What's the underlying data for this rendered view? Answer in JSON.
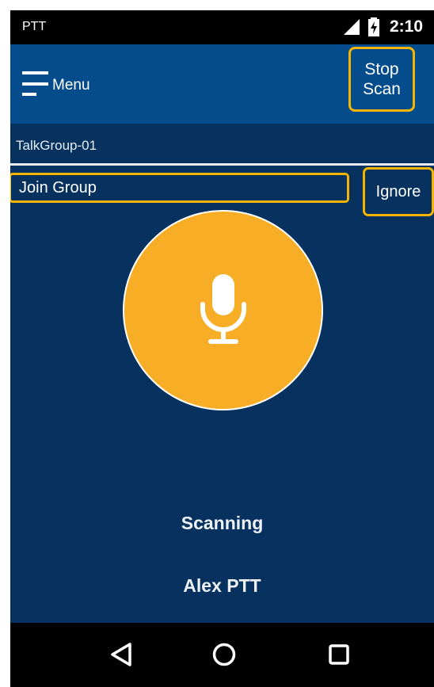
{
  "status_bar": {
    "app_label": "PTT",
    "time": "2:10",
    "icons": [
      "signal-icon",
      "battery-charging-icon"
    ]
  },
  "toolbar": {
    "menu_label": "Menu",
    "menu_icon": "hamburger-menu-icon",
    "stop_scan_line1": "Stop",
    "stop_scan_line2": "Scan"
  },
  "talkgroup": {
    "name": "TalkGroup-01"
  },
  "actions": {
    "join_label": "Join Group",
    "ignore_label": "Ignore"
  },
  "ptt": {
    "icon": "microphone-icon",
    "status": "Scanning",
    "user": "Alex PTT"
  },
  "nav": {
    "icons": [
      "back-icon",
      "home-icon",
      "recent-apps-icon"
    ]
  },
  "colors": {
    "background": "#07325f",
    "toolbar": "#044c8b",
    "ptt_button": "#f8ad27",
    "highlight": "#f4b400"
  }
}
